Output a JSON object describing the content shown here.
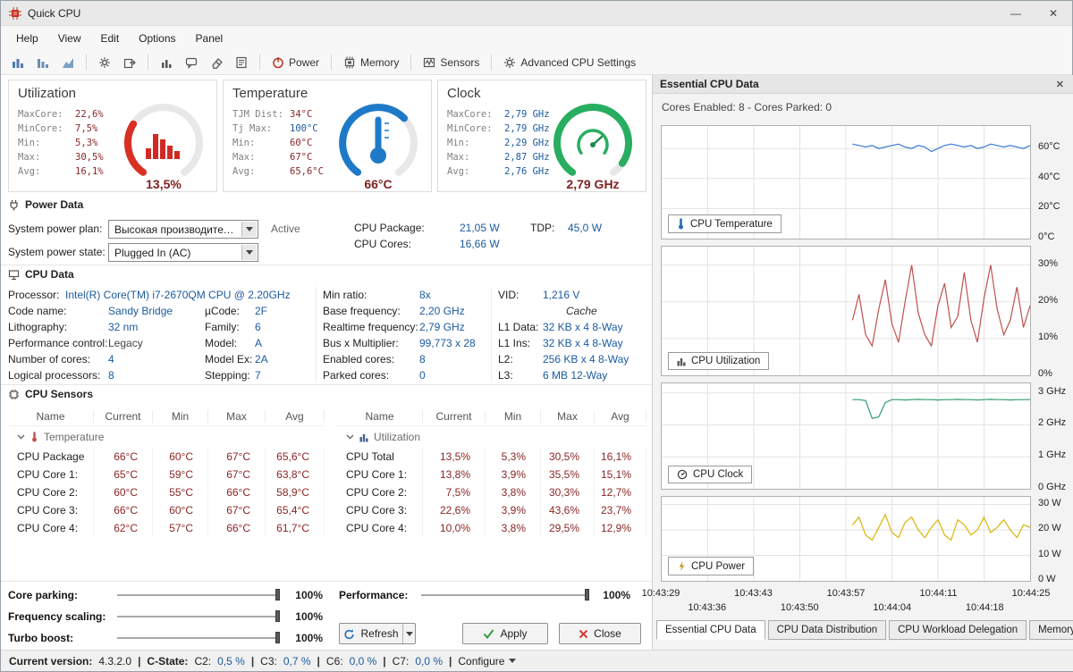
{
  "window": {
    "title": "Quick CPU"
  },
  "icons": {
    "minimize": "—",
    "close": "✕"
  },
  "menu": {
    "items": [
      "Help",
      "View",
      "Edit",
      "Options",
      "Panel"
    ]
  },
  "toolbar": {
    "power": "Power",
    "memory": "Memory",
    "sensors": "Sensors",
    "advanced": "Advanced CPU Settings"
  },
  "gauges": [
    {
      "title": "Utilization",
      "value": "13,5%",
      "fraction": 0.3,
      "color": "#d93025",
      "stats": [
        {
          "l": "MaxCore:",
          "v": "22,6%"
        },
        {
          "l": "MinCore:",
          "v": "7,5%"
        },
        {
          "l": "Min:",
          "v": "5,3%"
        },
        {
          "l": "Max:",
          "v": "30,5%"
        },
        {
          "l": "Avg:",
          "v": "16,1%"
        }
      ]
    },
    {
      "title": "Temperature",
      "value": "66°C",
      "fraction": 0.66,
      "color": "#1e7ac8",
      "stats": [
        {
          "l": "TJM Dist:",
          "v": "34°C"
        },
        {
          "l": "Tj Max:",
          "v": "100°C",
          "cls": "blue"
        },
        {
          "l": "Min:",
          "v": "60°C"
        },
        {
          "l": "Max:",
          "v": "67°C"
        },
        {
          "l": "Avg:",
          "v": "65,6°C"
        }
      ]
    },
    {
      "title": "Clock",
      "value": "2,79 GHz",
      "fraction": 0.93,
      "color": "#27ae60",
      "stats": [
        {
          "l": "MaxCore:",
          "v": "2,79 GHz",
          "cls": "blue"
        },
        {
          "l": "MinCore:",
          "v": "2,79 GHz",
          "cls": "blue"
        },
        {
          "l": "Min:",
          "v": "2,29 GHz",
          "cls": "blue"
        },
        {
          "l": "Max:",
          "v": "2,87 GHz",
          "cls": "blue"
        },
        {
          "l": "Avg:",
          "v": "2,76 GHz",
          "cls": "blue"
        }
      ]
    }
  ],
  "power": {
    "header": "Power Data",
    "plan_label": "System power plan:",
    "plan_value": "Высокая производительность",
    "active_label": "Active",
    "state_label": "System power state:",
    "state_value": "Plugged In (AC)",
    "fields_a": [
      {
        "l": "CPU Package:",
        "v": "21,05 W"
      },
      {
        "l": "CPU Cores:",
        "v": "16,66 W"
      }
    ],
    "fields_b": [
      {
        "l": "TDP:",
        "v": "45,0 W"
      }
    ]
  },
  "cpu": {
    "header": "CPU Data",
    "processor_label": "Processor:",
    "processor": "Intel(R) Core(TM) i7-2670QM CPU @ 2.20GHz",
    "col1": [
      {
        "l": "Code name:",
        "v": "Sandy Bridge"
      },
      {
        "l": "Lithography:",
        "v": "32 nm"
      },
      {
        "l": "Performance control:",
        "v": "Legacy",
        "cls": "plain"
      },
      {
        "l": "Number of cores:",
        "v": "4"
      },
      {
        "l": "Logical processors:",
        "v": "8"
      }
    ],
    "col2": [
      {
        "l": "µCode:",
        "v": "2F"
      },
      {
        "l": "Family:",
        "v": "6"
      },
      {
        "l": "Model:",
        "v": "A"
      },
      {
        "l": "Model Ex:",
        "v": "2A"
      },
      {
        "l": "Stepping:",
        "v": "7"
      }
    ],
    "col3": [
      {
        "l": "Min ratio:",
        "v": "8x"
      },
      {
        "l": "Base frequency:",
        "v": "2,20 GHz"
      },
      {
        "l": "Realtime frequency:",
        "v": "2,79 GHz"
      },
      {
        "l": "Bus x Multiplier:",
        "v": "99,773 x 28"
      },
      {
        "l": "Enabled cores:",
        "v": "8"
      },
      {
        "l": "Parked cores:",
        "v": "0"
      }
    ],
    "col4": [
      {
        "l": "VID:",
        "v": "1,216 V"
      },
      {
        "l": "",
        "v": "Cache",
        "cls": "cache"
      },
      {
        "l": "L1 Data:",
        "v": "32 KB x 4 8-Way"
      },
      {
        "l": "L1 Ins:",
        "v": "32 KB x 4 8-Way"
      },
      {
        "l": "L2:",
        "v": "256 KB x 4 8-Way"
      },
      {
        "l": "L3:",
        "v": "6 MB 12-Way"
      }
    ]
  },
  "sensors": {
    "header": "CPU Sensors",
    "columns": [
      "Name",
      "Current",
      "Min",
      "Max",
      "Avg"
    ],
    "temperature": {
      "group": "Temperature",
      "rows": [
        {
          "name": "CPU Package",
          "current": "66°C",
          "min": "60°C",
          "max": "67°C",
          "avg": "65,6°C"
        },
        {
          "name": "CPU Core 1:",
          "current": "65°C",
          "min": "59°C",
          "max": "67°C",
          "avg": "63,8°C"
        },
        {
          "name": "CPU Core 2:",
          "current": "60°C",
          "min": "55°C",
          "max": "66°C",
          "avg": "58,9°C"
        },
        {
          "name": "CPU Core 3:",
          "current": "66°C",
          "min": "60°C",
          "max": "67°C",
          "avg": "65,4°C"
        },
        {
          "name": "CPU Core 4:",
          "current": "62°C",
          "min": "57°C",
          "max": "66°C",
          "avg": "61,7°C"
        }
      ]
    },
    "utilization": {
      "group": "Utilization",
      "rows": [
        {
          "name": "CPU Total",
          "current": "13,5%",
          "min": "5,3%",
          "max": "30,5%",
          "avg": "16,1%"
        },
        {
          "name": "CPU Core 1:",
          "current": "13,8%",
          "min": "3,9%",
          "max": "35,5%",
          "avg": "15,1%"
        },
        {
          "name": "CPU Core 2:",
          "current": "7,5%",
          "min": "3,8%",
          "max": "30,3%",
          "avg": "12,7%"
        },
        {
          "name": "CPU Core 3:",
          "current": "22,6%",
          "min": "3,9%",
          "max": "43,6%",
          "avg": "23,7%"
        },
        {
          "name": "CPU Core 4:",
          "current": "10,0%",
          "min": "3,8%",
          "max": "29,5%",
          "avg": "12,9%"
        }
      ]
    }
  },
  "controls": {
    "sliders": [
      {
        "label": "Core parking:",
        "value": "100%"
      },
      {
        "label": "Frequency scaling:",
        "value": "100%"
      },
      {
        "label": "Turbo boost:",
        "value": "100%"
      }
    ],
    "performance": {
      "label": "Performance:",
      "value": "100%"
    },
    "refresh": "Refresh",
    "apply": "Apply",
    "close": "Close"
  },
  "status_bar": {
    "version_label": "Current version:",
    "version": "4.3.2.0",
    "sep": "|",
    "cstate_label": "C-State:",
    "cstates": [
      {
        "l": "C2:",
        "v": "0,5 %"
      },
      {
        "l": "C3:",
        "v": "0,7 %"
      },
      {
        "l": "C6:",
        "v": "0,0 %"
      },
      {
        "l": "C7:",
        "v": "0,0 %"
      }
    ],
    "configure": "Configure"
  },
  "side_panel": {
    "title": "Essential CPU Data",
    "subtitle": "Cores Enabled: 8 - Cores Parked: 0",
    "tabs": [
      {
        "label": "Essential CPU Data",
        "active": true
      },
      {
        "label": "CPU Data Distribution"
      },
      {
        "label": "CPU Workload Delegation"
      },
      {
        "label": "Memory Data"
      }
    ],
    "xticks_row1": [
      "10:43:29",
      "10:43:43",
      "10:43:57",
      "10:44:11",
      "10:44:25"
    ],
    "xticks_row2": [
      "10:43:36",
      "10:43:50",
      "10:44:04",
      "10:44:18"
    ]
  },
  "chart_data": [
    {
      "type": "line",
      "name": "CPU Temperature",
      "tag": "CPU Temperature",
      "color": "#3a7bd5",
      "ylim": [
        0,
        75
      ],
      "yticks": [
        60,
        40,
        20,
        0
      ],
      "ytick_labels": [
        "60°C",
        "40°C",
        "20°C",
        "0°C"
      ],
      "xlim_seconds": [
        0,
        56
      ],
      "x0": 29,
      "dx": 1,
      "values": [
        63,
        62,
        61,
        62,
        60,
        61,
        62,
        63,
        61,
        60,
        62,
        61,
        58,
        60,
        62,
        63,
        62,
        61,
        62,
        60,
        61,
        63,
        62,
        61,
        62,
        61,
        60,
        62
      ]
    },
    {
      "type": "line",
      "name": "CPU Utilization",
      "tag": "CPU Utilization",
      "color": "#c0504d",
      "ylim": [
        0,
        35
      ],
      "yticks": [
        30,
        20,
        10,
        0
      ],
      "ytick_labels": [
        "30%",
        "20%",
        "10%",
        "0%"
      ],
      "xlim_seconds": [
        0,
        56
      ],
      "x0": 29,
      "dx": 1,
      "values": [
        15,
        22,
        11,
        8,
        18,
        26,
        14,
        9,
        20,
        30,
        17,
        11,
        8,
        19,
        25,
        13,
        16,
        28,
        15,
        9,
        21,
        30,
        18,
        11,
        15,
        24,
        13,
        19
      ]
    },
    {
      "type": "line",
      "name": "CPU Clock",
      "tag": "CPU Clock",
      "color": "#2e9e6b",
      "ylim": [
        0,
        3.3
      ],
      "yticks": [
        3,
        2,
        1,
        0
      ],
      "ytick_labels": [
        "3 GHz",
        "2 GHz",
        "1 GHz",
        "0 GHz"
      ],
      "xlim_seconds": [
        0,
        56
      ],
      "x0": 29,
      "dx": 1,
      "values": [
        2.79,
        2.79,
        2.76,
        2.2,
        2.25,
        2.7,
        2.79,
        2.79,
        2.78,
        2.79,
        2.8,
        2.79,
        2.79,
        2.78,
        2.79,
        2.79,
        2.8,
        2.79,
        2.79,
        2.78,
        2.79,
        2.8,
        2.79,
        2.79,
        2.78,
        2.79,
        2.79,
        2.79
      ]
    },
    {
      "type": "line",
      "name": "CPU Power",
      "tag": "CPU Power",
      "color": "#d9b50a",
      "ylim": [
        0,
        33
      ],
      "yticks": [
        30,
        20,
        10,
        0
      ],
      "ytick_labels": [
        "30 W",
        "20 W",
        "10 W",
        "0 W"
      ],
      "xlim_seconds": [
        0,
        56
      ],
      "x0": 29,
      "dx": 1,
      "values": [
        22,
        25,
        18,
        16,
        21,
        26,
        19,
        17,
        23,
        25,
        20,
        17,
        21,
        24,
        18,
        16,
        24,
        22,
        18,
        20,
        25,
        19,
        21,
        24,
        20,
        17,
        22,
        21
      ]
    }
  ]
}
